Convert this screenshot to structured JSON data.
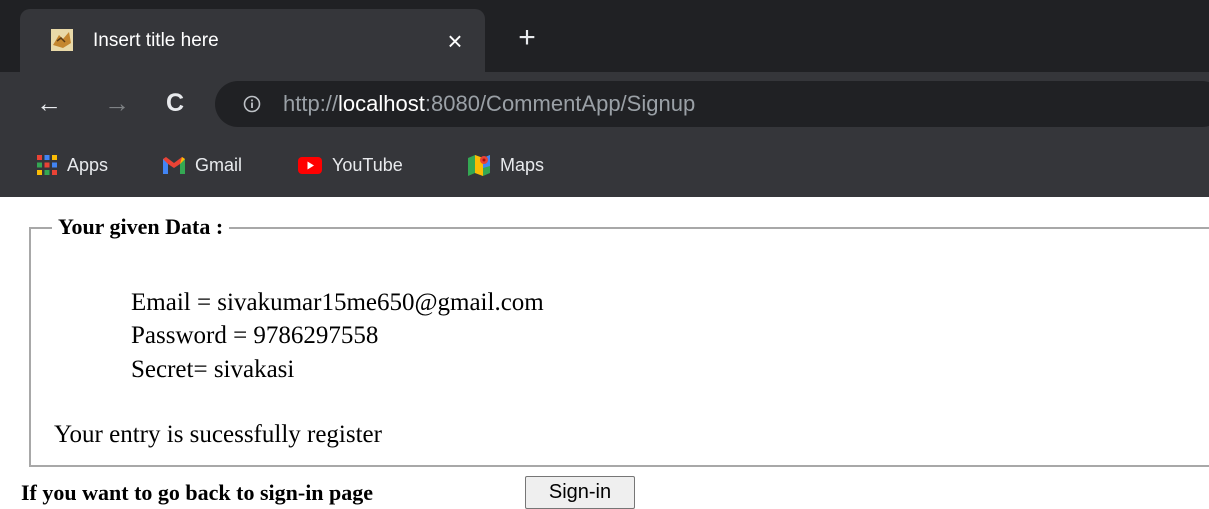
{
  "browser": {
    "tab": {
      "title": "Insert title here",
      "close_glyph": "×"
    },
    "new_tab_glyph": "+",
    "toolbar": {
      "back_glyph": "←",
      "forward_glyph": "→",
      "reload_glyph": "C",
      "url": {
        "scheme": "http://",
        "host": "localhost",
        "rest": ":8080/CommentApp/Signup"
      }
    },
    "bookmarks": [
      {
        "label": "Apps",
        "icon": "apps-grid-icon"
      },
      {
        "label": "Gmail",
        "icon": "gmail-icon"
      },
      {
        "label": "YouTube",
        "icon": "youtube-icon"
      },
      {
        "label": "Maps",
        "icon": "maps-icon"
      }
    ]
  },
  "page": {
    "fieldset_legend": "Your given Data :",
    "details": {
      "email": "Email = sivakumar15me650@gmail.com",
      "password": "Password = 9786297558",
      "secret": "Secret= sivakasi"
    },
    "status_message": "Your entry is sucessfully register",
    "back_prompt": "If you want to go back to sign-in page",
    "signin_button": "Sign-in"
  },
  "colors": {
    "tabstrip_bg": "#202124",
    "toolbar_bg": "#35363a",
    "youtube_red": "#ff0000",
    "fieldset_border": "#a8a8a8"
  }
}
